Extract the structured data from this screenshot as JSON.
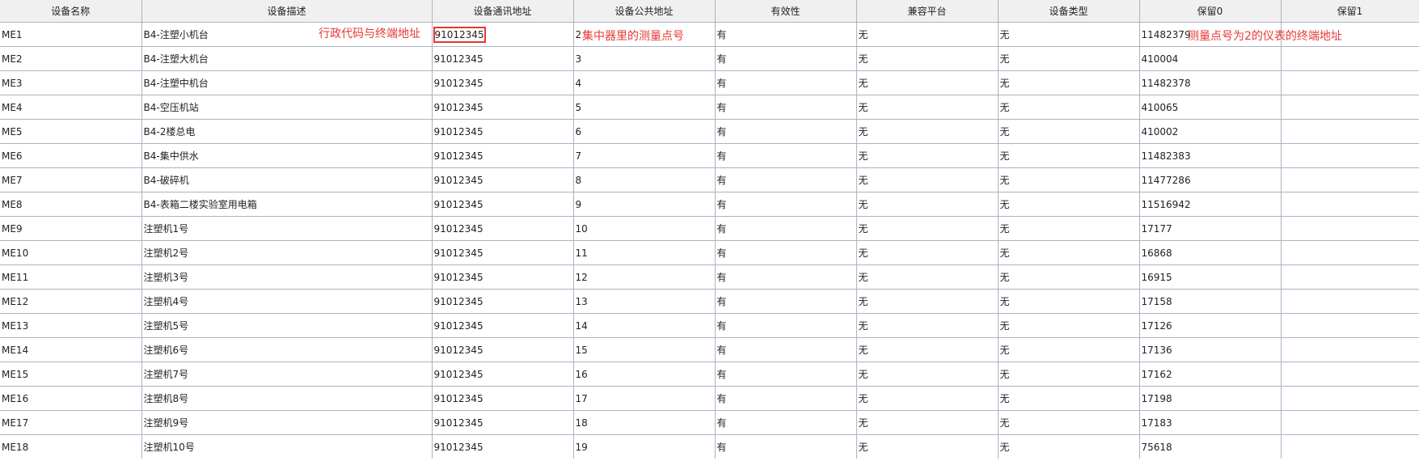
{
  "headers": [
    "设备名称",
    "设备描述",
    "设备通讯地址",
    "设备公共地址",
    "有效性",
    "兼容平台",
    "设备类型",
    "保留0",
    "保留1"
  ],
  "annotations": {
    "desc_note": "行政代码与终端地址",
    "public_note": "集中器里的测量点号",
    "reserve_note": "测量点号为2的仪表的终端地址"
  },
  "colors": {
    "annotation": "#e53935",
    "border": "#a9b4c2",
    "header_bg": "#f0f0f0"
  },
  "rows": [
    {
      "name": "ME1",
      "desc": "B4-注塑小机台",
      "comm": "91012345",
      "public": "2",
      "valid": "有",
      "platform": "无",
      "type": "无",
      "r0": "11482379",
      "r1": ""
    },
    {
      "name": "ME2",
      "desc": "B4-注塑大机台",
      "comm": "91012345",
      "public": "3",
      "valid": "有",
      "platform": "无",
      "type": "无",
      "r0": "410004",
      "r1": ""
    },
    {
      "name": "ME3",
      "desc": "B4-注塑中机台",
      "comm": "91012345",
      "public": "4",
      "valid": "有",
      "platform": "无",
      "type": "无",
      "r0": "11482378",
      "r1": ""
    },
    {
      "name": "ME4",
      "desc": "B4-空压机站",
      "comm": "91012345",
      "public": "5",
      "valid": "有",
      "platform": "无",
      "type": "无",
      "r0": "410065",
      "r1": ""
    },
    {
      "name": "ME5",
      "desc": "B4-2楼总电",
      "comm": "91012345",
      "public": "6",
      "valid": "有",
      "platform": "无",
      "type": "无",
      "r0": "410002",
      "r1": ""
    },
    {
      "name": "ME6",
      "desc": "B4-集中供水",
      "comm": "91012345",
      "public": "7",
      "valid": "有",
      "platform": "无",
      "type": "无",
      "r0": "11482383",
      "r1": ""
    },
    {
      "name": "ME7",
      "desc": "B4-破碎机",
      "comm": "91012345",
      "public": "8",
      "valid": "有",
      "platform": "无",
      "type": "无",
      "r0": "11477286",
      "r1": ""
    },
    {
      "name": "ME8",
      "desc": "B4-表箱二楼实验室用电箱",
      "comm": "91012345",
      "public": "9",
      "valid": "有",
      "platform": "无",
      "type": "无",
      "r0": "11516942",
      "r1": ""
    },
    {
      "name": "ME9",
      "desc": "注塑机1号",
      "comm": "91012345",
      "public": "10",
      "valid": "有",
      "platform": "无",
      "type": "无",
      "r0": "17177",
      "r1": ""
    },
    {
      "name": "ME10",
      "desc": "注塑机2号",
      "comm": "91012345",
      "public": "11",
      "valid": "有",
      "platform": "无",
      "type": "无",
      "r0": "16868",
      "r1": ""
    },
    {
      "name": "ME11",
      "desc": "注塑机3号",
      "comm": "91012345",
      "public": "12",
      "valid": "有",
      "platform": "无",
      "type": "无",
      "r0": "16915",
      "r1": ""
    },
    {
      "name": "ME12",
      "desc": "注塑机4号",
      "comm": "91012345",
      "public": "13",
      "valid": "有",
      "platform": "无",
      "type": "无",
      "r0": "17158",
      "r1": ""
    },
    {
      "name": "ME13",
      "desc": "注塑机5号",
      "comm": "91012345",
      "public": "14",
      "valid": "有",
      "platform": "无",
      "type": "无",
      "r0": "17126",
      "r1": ""
    },
    {
      "name": "ME14",
      "desc": "注塑机6号",
      "comm": "91012345",
      "public": "15",
      "valid": "有",
      "platform": "无",
      "type": "无",
      "r0": "17136",
      "r1": ""
    },
    {
      "name": "ME15",
      "desc": "注塑机7号",
      "comm": "91012345",
      "public": "16",
      "valid": "有",
      "platform": "无",
      "type": "无",
      "r0": "17162",
      "r1": ""
    },
    {
      "name": "ME16",
      "desc": "注塑机8号",
      "comm": "91012345",
      "public": "17",
      "valid": "有",
      "platform": "无",
      "type": "无",
      "r0": "17198",
      "r1": ""
    },
    {
      "name": "ME17",
      "desc": "注塑机9号",
      "comm": "91012345",
      "public": "18",
      "valid": "有",
      "platform": "无",
      "type": "无",
      "r0": "17183",
      "r1": ""
    },
    {
      "name": "ME18",
      "desc": "注塑机10号",
      "comm": "91012345",
      "public": "19",
      "valid": "有",
      "platform": "无",
      "type": "无",
      "r0": "75618",
      "r1": ""
    }
  ]
}
